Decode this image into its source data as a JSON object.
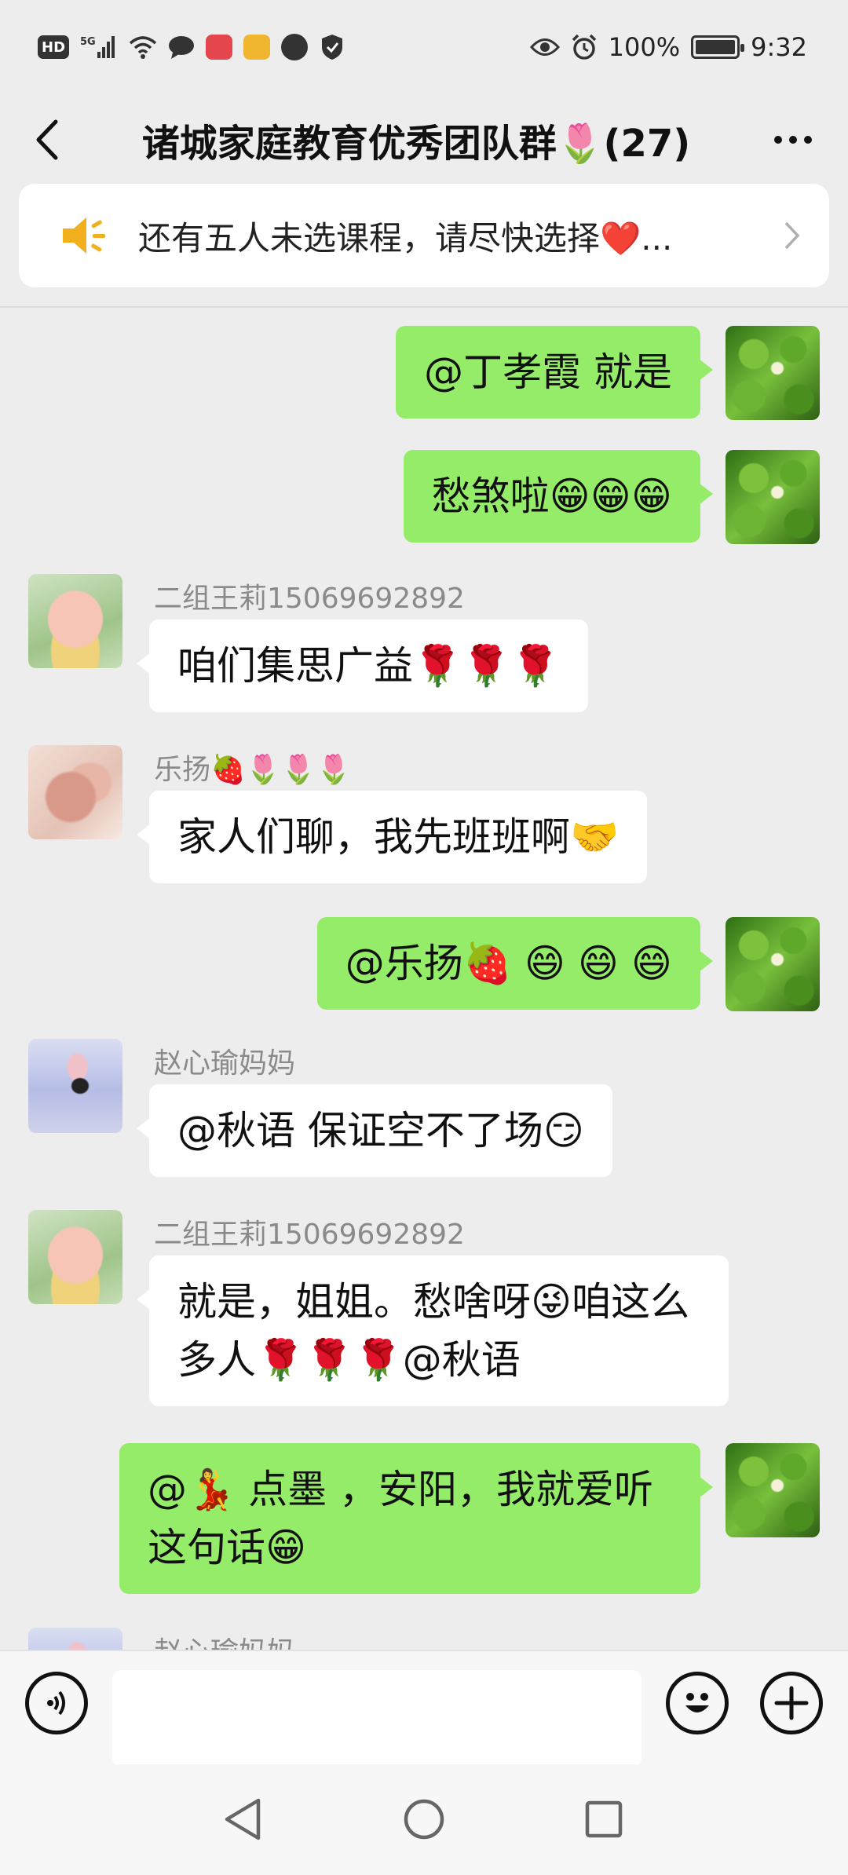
{
  "status_bar": {
    "left_icons": [
      "hd-icon",
      "5g-signal-icon",
      "wifi-icon",
      "chat-bubble-icon",
      "red-app-icon",
      "yellow-app-icon",
      "globe-icon",
      "shield-icon"
    ],
    "hd_label": "HD",
    "network_label": "5G",
    "battery_percent": "100%",
    "battery_level": 1.0,
    "time": "9:32"
  },
  "title_bar": {
    "title": "诸城家庭教育优秀团队群🌷(27)"
  },
  "notice": {
    "text": "还有五人未选课程，请尽快选择❤️..."
  },
  "messages": [
    {
      "side": "self",
      "text": "@丁孝霞  就是"
    },
    {
      "side": "self",
      "text": "愁煞啦😁😁😁"
    },
    {
      "side": "other",
      "sender": "二组王莉15069692892",
      "avatar": "pig",
      "text": "咱们集思广益🌹🌹🌹"
    },
    {
      "side": "other",
      "sender": "乐扬🍓🌷🌷🌷",
      "avatar": "hands",
      "text": "家人们聊，我先班班啊🤝"
    },
    {
      "side": "self",
      "text": "@乐扬🍓 😄 😄 😄"
    },
    {
      "side": "other",
      "sender": "赵心瑜妈妈",
      "avatar": "girl",
      "text": "@秋语  保证空不了场😏"
    },
    {
      "side": "other",
      "sender": "二组王莉15069692892",
      "avatar": "pig",
      "text": "就是，姐姐。愁啥呀😜咱这么多人🌹🌹🌹@秋语"
    },
    {
      "side": "self",
      "text": "@💃 点墨 ，安阳，我就爱听这句话😁"
    },
    {
      "side": "other",
      "sender": "赵心瑜妈妈",
      "avatar": "girl",
      "text": ""
    }
  ],
  "input_bar": {
    "value": "",
    "placeholder": ""
  },
  "icons": {
    "back": "back-arrow-icon",
    "more": "more-dots-icon",
    "notice": "speaker-icon",
    "chevron": "chevron-right-icon",
    "voice": "voice-icon",
    "emoji": "emoji-icon",
    "plus": "plus-icon",
    "nav_back": "nav-back-icon",
    "nav_home": "nav-home-icon",
    "nav_recent": "nav-recent-icon"
  },
  "colors": {
    "background": "#ededed",
    "self_bubble": "#95ec69",
    "other_bubble": "#ffffff",
    "sender_name": "#8a8a8a",
    "notice_icon": "#f2b01e"
  }
}
